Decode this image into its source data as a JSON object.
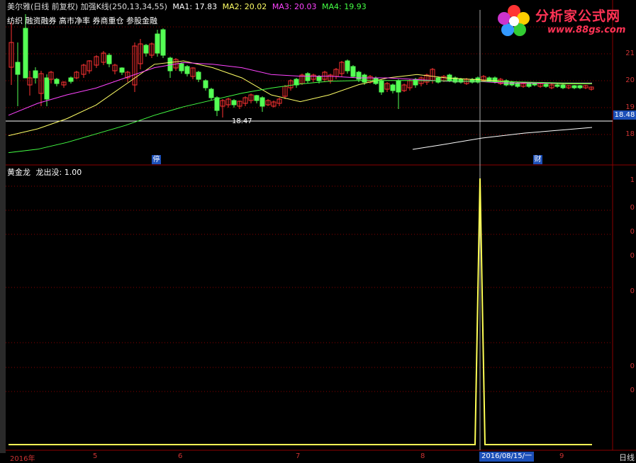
{
  "header": {
    "stock": "美尔雅(日线 前复权)",
    "indicator": "加强K线(250,13,34,55)",
    "ma1": "MA1: 17.83",
    "ma2": "MA2: 20.02",
    "ma3": "MA3: 20.03",
    "ma4": "MA4: 19.93",
    "concepts": "纺织 融资融券 高市净率 券商重仓 参股金融"
  },
  "watermark": {
    "title": "分析家公式网",
    "url": "www.88gs.com"
  },
  "main_panel": {
    "price_levels": [
      "21",
      "20",
      "19",
      "18"
    ],
    "current_price": "18.48",
    "min_label": "18.47",
    "marker_stop": "停",
    "marker_finance": "财"
  },
  "sub_panel": {
    "title": "黄金龙",
    "value_label": "龙出没: 1.00",
    "levels": [
      "1",
      "0",
      "0",
      "0",
      "0",
      "0",
      "0"
    ]
  },
  "timeline": {
    "year": "2016年",
    "months": [
      "5",
      "6",
      "7",
      "8",
      "9"
    ],
    "cursor_date": "2016/08/15/一",
    "period": "日线"
  },
  "colors": {
    "bg": "#000000",
    "up": "#ff3232",
    "down": "#54ff54",
    "ma1": "#ffffff",
    "ma2": "#ffff66",
    "ma3": "#ff44ff",
    "ma4": "#44ff44",
    "grid": "#8b0000",
    "indicator": "#ffff55"
  },
  "chart_data": [
    {
      "type": "line",
      "series": [
        {
          "name": "MA2",
          "values": [
            18.4,
            18.6,
            18.9,
            19.3,
            19.9,
            20.5,
            20.6,
            20.4,
            20.1,
            19.6,
            19.4,
            19.6,
            19.9,
            20.1,
            20.2,
            20.1,
            20.05,
            20.0,
            19.95,
            19.93,
            19.93
          ]
        },
        {
          "name": "MA3",
          "values": [
            19.0,
            19.35,
            19.6,
            19.8,
            20.1,
            20.4,
            20.55,
            20.5,
            20.4,
            20.2,
            20.15,
            20.15,
            20.1,
            20.1,
            20.05,
            20.0,
            20.0,
            19.95,
            19.95,
            19.95,
            19.95
          ]
        },
        {
          "name": "MA4",
          "values": [
            17.9,
            18.0,
            18.2,
            18.45,
            18.7,
            19.0,
            19.25,
            19.45,
            19.65,
            19.8,
            19.92,
            20.0,
            20.02,
            20.02,
            20.02,
            20.01,
            20.0,
            19.99,
            19.97,
            19.95,
            19.94
          ]
        }
      ]
    },
    {
      "type": "line",
      "title": "龙出没",
      "series": [
        {
          "name": "龙出没",
          "values": [
            0,
            0,
            0,
            0,
            0,
            0,
            0,
            0,
            0,
            0,
            1,
            0,
            0,
            0,
            0
          ]
        }
      ]
    }
  ]
}
